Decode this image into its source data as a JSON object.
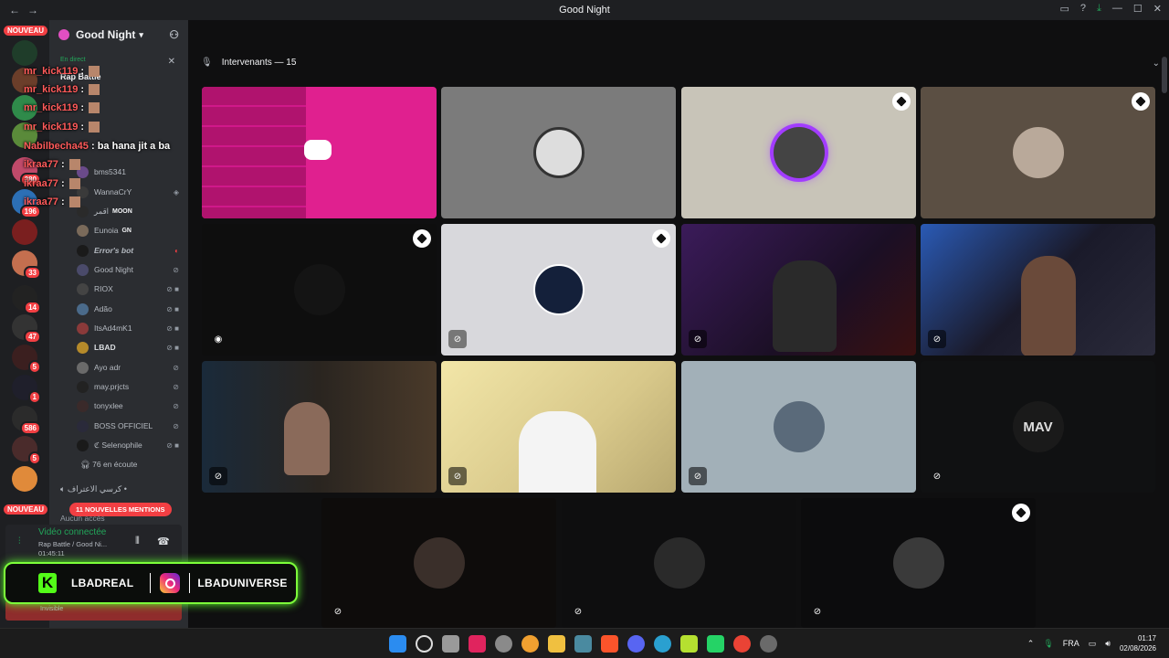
{
  "window": {
    "title": "Good Night",
    "back": "←",
    "forward": "→"
  },
  "rail": {
    "nouveau_top": "NOUVEAU",
    "nouveau_bottom": "NOUVEAU",
    "badges": [
      "280",
      "196",
      "33",
      "14",
      "47",
      "5",
      "1",
      "586",
      "5"
    ]
  },
  "sidebar": {
    "server_name": "Good Night",
    "live_label": "En direct",
    "live_title": "Rap Battle",
    "members": [
      {
        "name": "bms5341",
        "tag": ""
      },
      {
        "name": "WannaCrY",
        "tag": ""
      },
      {
        "name": "اقمر",
        "tag": "MOON"
      },
      {
        "name": "Eunoia",
        "tag": "GN"
      },
      {
        "name": "Error's bot",
        "tag": ""
      },
      {
        "name": "Good Night",
        "tag": ""
      },
      {
        "name": "RIOX",
        "tag": ""
      },
      {
        "name": "Adão",
        "tag": ""
      },
      {
        "name": "ItsAd4mK1",
        "tag": ""
      },
      {
        "name": "LBAD",
        "tag": ""
      },
      {
        "name": "Ayo adr",
        "tag": ""
      },
      {
        "name": "may.prjcts",
        "tag": ""
      },
      {
        "name": "tonyxlee",
        "tag": ""
      },
      {
        "name": "BOSS OFFICIEL",
        "tag": ""
      },
      {
        "name": "ℭ Selenophile",
        "tag": ""
      }
    ],
    "listening": "76 en écoute",
    "channel2": "كرسي الاعتراف •",
    "mentions": "11 NOUVELLES MENTIONS",
    "no_access": "Aucun accès"
  },
  "voice": {
    "status": "Vidéo connectée",
    "channel": "Rap Battle / Good Ni...",
    "time": "01:45:11",
    "user_status": "Invisible"
  },
  "chat_overlay": [
    {
      "user": "mr_kick119",
      "msg": ""
    },
    {
      "user": "mr_kick119",
      "msg": ""
    },
    {
      "user": "mr_kick119",
      "msg": ""
    },
    {
      "user": "mr_kick119",
      "msg": ""
    },
    {
      "user": "Nabilbecha45",
      "msg": "ba hana jit a ba"
    },
    {
      "user": "ikraa77",
      "msg": ""
    },
    {
      "user": "ikraa77",
      "msg": ""
    },
    {
      "user": "ikraa77",
      "msg": ""
    }
  ],
  "social": {
    "kick_handle": "LBADREAL",
    "insta_handle": "LBADUNIVERSE"
  },
  "stage": {
    "header": "Intervenants — 15"
  },
  "taskbar": {
    "lang": "FRA",
    "time": "01:17",
    "date": "02/08/2026"
  },
  "colors": {
    "accent_green": "#23a55a",
    "danger": "#f23f43",
    "blurple": "#5865f2",
    "brand_pink": "#e0208f"
  }
}
